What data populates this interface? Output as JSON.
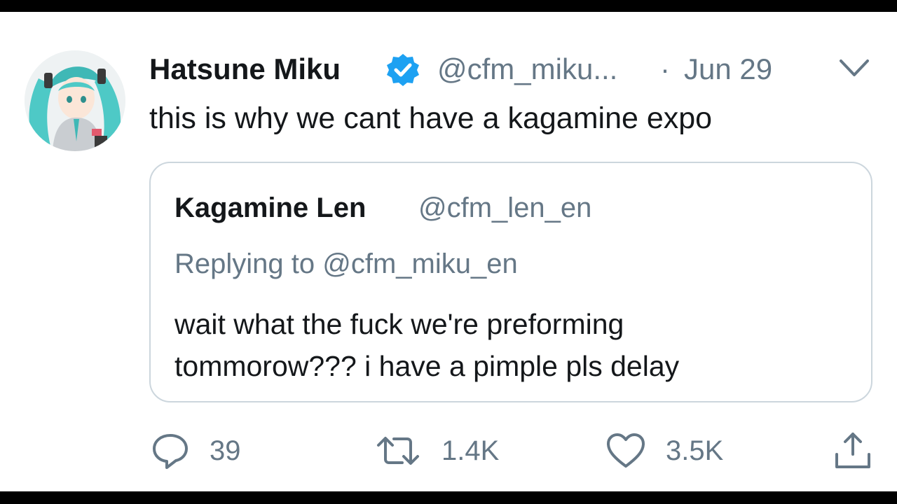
{
  "tweet": {
    "author_name": "Hatsune Miku",
    "author_handle": "@cfm_miku...",
    "separator": "·",
    "date": "Jun 29",
    "text": "this is why we cant have a kagamine expo",
    "avatar_icon": "anime-character-avatar",
    "verified_icon": "verified-badge-icon",
    "menu_icon": "chevron-down-icon"
  },
  "quoted": {
    "author_name": "Kagamine Len",
    "author_handle": "@cfm_len_en",
    "replying_to": "Replying to @cfm_miku_en",
    "text_lines": [
      "wait what the fuck we're preforming",
      "tommorow??? i have a pimple pls delay"
    ]
  },
  "actions": {
    "reply": {
      "icon": "reply-icon",
      "count": "39"
    },
    "retweet": {
      "icon": "retweet-icon",
      "count": "1.4K"
    },
    "like": {
      "icon": "heart-icon",
      "count": "3.5K"
    },
    "share": {
      "icon": "share-icon"
    }
  },
  "colors": {
    "text_primary": "#14171a",
    "text_secondary": "#657786",
    "verified_blue": "#1da1f2",
    "border": "#ccd6dd",
    "avatar_hair": "#4ec9c6"
  }
}
